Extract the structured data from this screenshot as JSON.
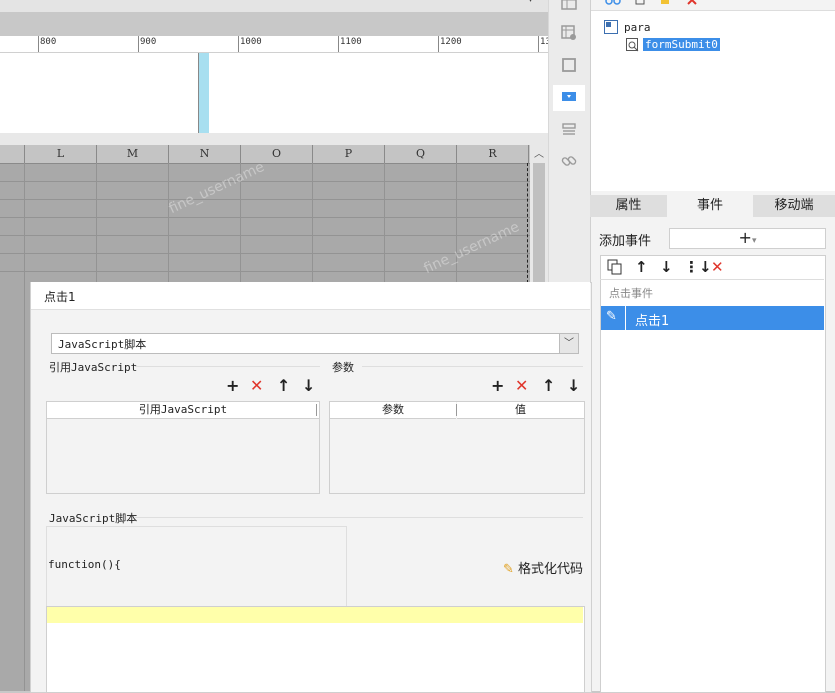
{
  "ruler": {
    "labels": [
      "800",
      "900",
      "1000",
      "1100",
      "1200",
      "13"
    ]
  },
  "sheet": {
    "columns": [
      "L",
      "M",
      "N",
      "O",
      "P",
      "Q",
      "R"
    ],
    "watermark": "fine_username"
  },
  "tree": {
    "root_label": "para",
    "child_label": "formSubmit0"
  },
  "tabs": [
    "属性",
    "事件",
    "移动端"
  ],
  "event_panel": {
    "add_event_label": "添加事件",
    "add_symbol": "+",
    "group_label": "点击事件",
    "selected_event": "点击1"
  },
  "dialog": {
    "title": "点击1",
    "type_select": "JavaScript脚本",
    "ref_js_section": "引用JavaScript",
    "param_section": "参数",
    "ref_js_col": "引用JavaScript",
    "param_col": "参数",
    "value_col": "值",
    "js_section": "JavaScript脚本",
    "function_text": "function(){",
    "format_label": "格式化代码"
  },
  "colors": {
    "accent": "#3c8ee8",
    "delete_red": "#e0352b",
    "editor_highlight": "#ffffaa",
    "canvas_marker": "#a8dff0"
  }
}
